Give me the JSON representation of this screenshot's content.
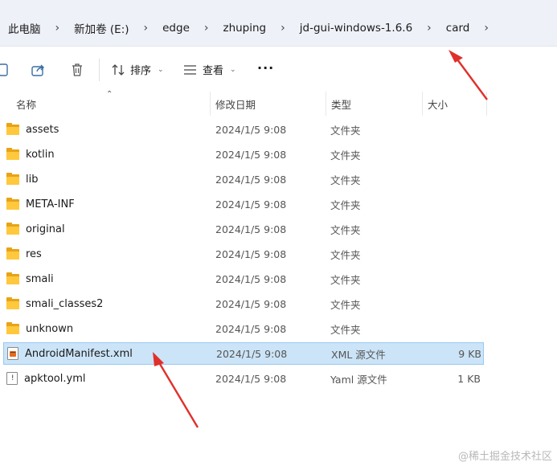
{
  "breadcrumb": {
    "items": [
      "此电脑",
      "新加卷 (E:)",
      "edge",
      "zhuping",
      "jd-gui-windows-1.6.6",
      "card"
    ],
    "separator": "›"
  },
  "toolbar": {
    "sort_label": "排序",
    "view_label": "查看",
    "more_label": "···"
  },
  "columns": {
    "name": "名称",
    "date": "修改日期",
    "type": "类型",
    "size": "大小"
  },
  "files": [
    {
      "name": "assets",
      "date": "2024/1/5 9:08",
      "type": "文件夹",
      "size": "",
      "icon": "folder-icon"
    },
    {
      "name": "kotlin",
      "date": "2024/1/5 9:08",
      "type": "文件夹",
      "size": "",
      "icon": "folder-icon"
    },
    {
      "name": "lib",
      "date": "2024/1/5 9:08",
      "type": "文件夹",
      "size": "",
      "icon": "folder-icon"
    },
    {
      "name": "META-INF",
      "date": "2024/1/5 9:08",
      "type": "文件夹",
      "size": "",
      "icon": "folder-icon"
    },
    {
      "name": "original",
      "date": "2024/1/5 9:08",
      "type": "文件夹",
      "size": "",
      "icon": "folder-icon"
    },
    {
      "name": "res",
      "date": "2024/1/5 9:08",
      "type": "文件夹",
      "size": "",
      "icon": "folder-icon"
    },
    {
      "name": "smali",
      "date": "2024/1/5 9:08",
      "type": "文件夹",
      "size": "",
      "icon": "folder-icon"
    },
    {
      "name": "smali_classes2",
      "date": "2024/1/5 9:08",
      "type": "文件夹",
      "size": "",
      "icon": "folder-icon"
    },
    {
      "name": "unknown",
      "date": "2024/1/5 9:08",
      "type": "文件夹",
      "size": "",
      "icon": "folder-icon"
    },
    {
      "name": "AndroidManifest.xml",
      "date": "2024/1/5 9:08",
      "type": "XML 源文件",
      "size": "9 KB",
      "icon": "xml-file-icon",
      "selected": true
    },
    {
      "name": "apktool.yml",
      "date": "2024/1/5 9:08",
      "type": "Yaml 源文件",
      "size": "1 KB",
      "icon": "yaml-file-icon"
    }
  ],
  "watermark": "@稀土掘金技术社区",
  "colors": {
    "folder": "#ffc83d",
    "selection": "#cce4f7",
    "arrow": "#e0302a"
  }
}
